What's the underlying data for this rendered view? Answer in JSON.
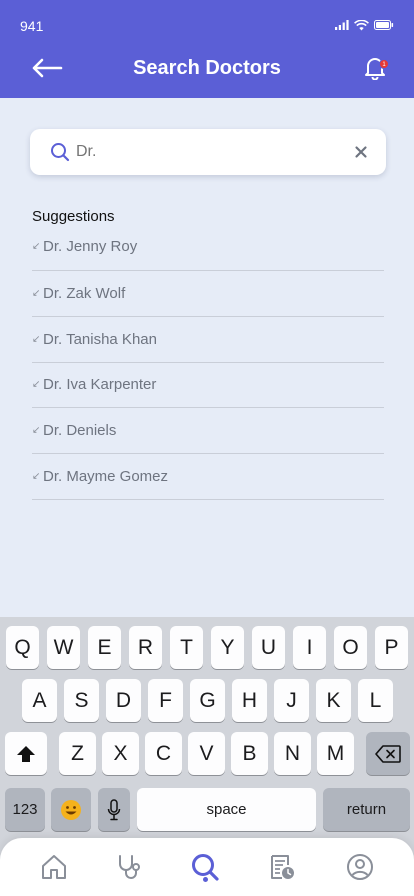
{
  "status_bar": {
    "time": "941"
  },
  "header": {
    "title": "Search Doctors",
    "notification_count": "1"
  },
  "search": {
    "value": "",
    "placeholder": "Dr."
  },
  "suggestions": {
    "title": "Suggestions",
    "items": [
      {
        "label": "Dr. Jenny Roy"
      },
      {
        "label": "Dr. Zak Wolf"
      },
      {
        "label": "Dr. Tanisha Khan"
      },
      {
        "label": "Dr. Iva Karpenter"
      },
      {
        "label": "Dr. Deniels"
      },
      {
        "label": "Dr. Mayme Gomez"
      }
    ]
  },
  "keyboard": {
    "row1": [
      "Q",
      "W",
      "E",
      "R",
      "T",
      "Y",
      "U",
      "I",
      "O",
      "P"
    ],
    "row2": [
      "A",
      "S",
      "D",
      "F",
      "G",
      "H",
      "J",
      "K",
      "L"
    ],
    "row3": [
      "Z",
      "X",
      "C",
      "V",
      "B",
      "N",
      "M"
    ],
    "numbers_label": "123",
    "space_label": "space",
    "return_label": "return"
  },
  "bottom_nav": {
    "items": [
      "home-icon",
      "stethoscope-icon",
      "search-icon",
      "records-icon",
      "profile-icon"
    ],
    "active": "search-icon"
  },
  "colors": {
    "primary": "#5b5fd6",
    "background": "#e6ecf7",
    "text_muted": "#6e7480",
    "badge": "#e53935"
  }
}
